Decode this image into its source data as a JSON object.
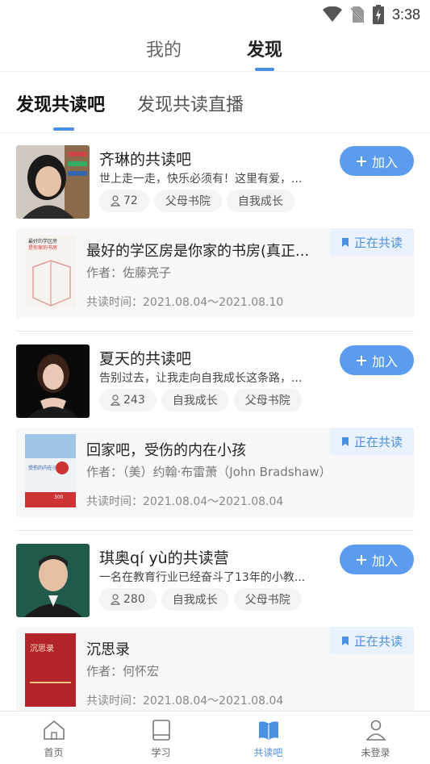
{
  "status_bar": {
    "time": "3:38",
    "icons": [
      "wifi-icon",
      "no-sim-icon",
      "battery-charging-icon"
    ]
  },
  "top_tabs": [
    {
      "label": "我的",
      "active": false
    },
    {
      "label": "发现",
      "active": true
    }
  ],
  "sub_tabs": [
    {
      "label": "发现共读吧",
      "active": true
    },
    {
      "label": "发现共读直播",
      "active": false
    }
  ],
  "colors": {
    "accent": "#4a90e2",
    "join_button": "#5b9cf0",
    "badge_bg": "#e8f1fd"
  },
  "clubs": [
    {
      "name": "齐琳的共读吧",
      "desc": "世上走一走，快乐必须有！这里有爱，...",
      "members": "72",
      "tags": [
        "父母书院",
        "自我成长"
      ],
      "join_label": "加入",
      "book": {
        "title": "最好的学区房是你家的书房(真正...",
        "author": "作者：佐藤亮子",
        "time": "共读时间：2021.08.04～2021.08.10",
        "badge": "正在共读",
        "cover_text": "最好的学区房是你家的书房"
      }
    },
    {
      "name": "夏天的共读吧",
      "desc": "告别过去，让我走向自我成长这条路，...",
      "members": "243",
      "tags": [
        "自我成长",
        "父母书院"
      ],
      "join_label": "加入",
      "book": {
        "title": "回家吧，受伤的内在小孩",
        "author": "作者：（美）约翰·布雷萧（John Bradshaw）",
        "time": "共读时间：2021.08.04～2021.08.04",
        "badge": "正在共读",
        "cover_text": "受伤的内在小孩"
      }
    },
    {
      "name": "琪奥qí yù的共读营",
      "desc": "一名在教育行业已经奋斗了13年的小教...",
      "members": "280",
      "tags": [
        "自我成长",
        "父母书院"
      ],
      "join_label": "加入",
      "book": {
        "title": "沉思录",
        "author": "作者：何怀宏",
        "time": "共读时间：2021.08.04～2021.08.04",
        "badge": "正在共读",
        "cover_text": "沉思录"
      }
    }
  ],
  "bottom_nav": [
    {
      "label": "首页",
      "icon": "home-icon",
      "active": false
    },
    {
      "label": "学习",
      "icon": "book-icon",
      "active": false
    },
    {
      "label": "共读吧",
      "icon": "open-book-icon",
      "active": true
    },
    {
      "label": "未登录",
      "icon": "user-icon",
      "active": false
    }
  ]
}
